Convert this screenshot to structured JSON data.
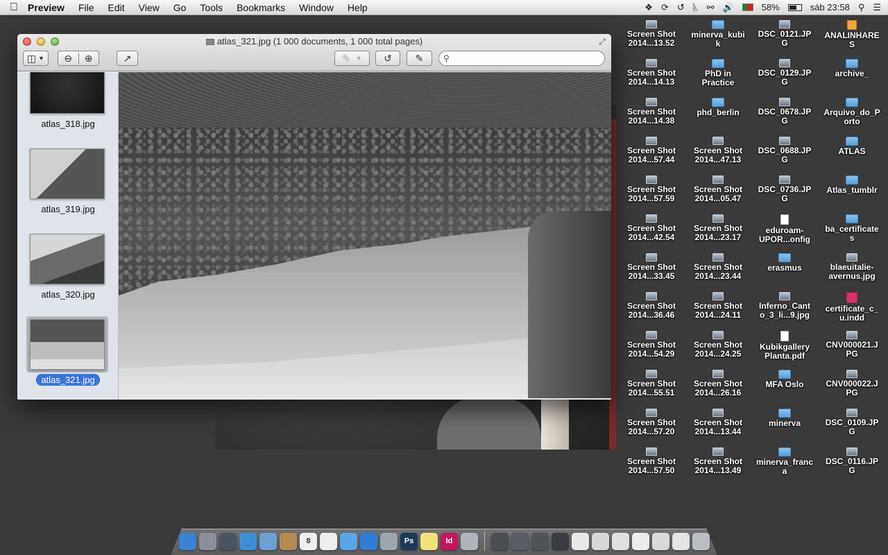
{
  "menubar": {
    "app_name": "Preview",
    "items": [
      "File",
      "Edit",
      "View",
      "Go",
      "Tools",
      "Bookmarks",
      "Window",
      "Help"
    ],
    "battery_percent": "58%",
    "clock": "sáb 23:58"
  },
  "window": {
    "title": "atlas_321.jpg (1 000 documents, 1 000 total pages)",
    "search_placeholder": ""
  },
  "sidebar": {
    "items": [
      {
        "label": "atlas_318.jpg",
        "selected": false
      },
      {
        "label": "atlas_319.jpg",
        "selected": false
      },
      {
        "label": "atlas_320.jpg",
        "selected": false
      },
      {
        "label": "atlas_321.jpg",
        "selected": true
      }
    ]
  },
  "desktop": {
    "col1": [
      [
        "Screen Shot",
        "2014...13.52"
      ],
      [
        "Screen Shot",
        "2014...14.13"
      ],
      [
        "Screen Shot",
        "2014...14.38"
      ],
      [
        "Screen Shot",
        "2014...57.44"
      ],
      [
        "Screen Shot",
        "2014...57.59"
      ],
      [
        "Screen Shot",
        "2014...42.54"
      ],
      [
        "Screen Shot",
        "2014...33.45"
      ],
      [
        "Screen Shot",
        "2014...36.46"
      ],
      [
        "Screen Shot",
        "2014...54.29"
      ],
      [
        "Screen Shot",
        "2014...55.51"
      ],
      [
        "Screen Shot",
        "2014...57.20"
      ],
      [
        "Screen Shot",
        "2014...57.50"
      ]
    ],
    "col2": [
      [
        "minerva_kubi",
        "k"
      ],
      [
        "PhD in",
        "Practice"
      ],
      [
        "phd_berlin",
        ""
      ],
      [
        "Screen Shot",
        "2014...47.13"
      ],
      [
        "Screen Shot",
        "2014...05.47"
      ],
      [
        "Screen Shot",
        "2014...23.17"
      ],
      [
        "Screen Shot",
        "2014...23.44"
      ],
      [
        "Screen Shot",
        "2014...24.11"
      ],
      [
        "Screen Shot",
        "2014...24.25"
      ],
      [
        "Screen Shot",
        "2014...26.16"
      ],
      [
        "Screen Shot",
        "2014...13.44"
      ],
      [
        "Screen Shot",
        "2014...13.49"
      ]
    ],
    "col3": [
      [
        "DSC_0121.JP",
        "G"
      ],
      [
        "DSC_0129.JP",
        "G"
      ],
      [
        "DSC_0678.JP",
        "G"
      ],
      [
        "DSC_0688.JP",
        "G"
      ],
      [
        "DSC_0736.JP",
        "G"
      ],
      [
        "eduroam-",
        "UPOR...onfig"
      ],
      [
        "erasmus",
        ""
      ],
      [
        "Inferno_Cant",
        "o_3_li...9.jpg"
      ],
      [
        "Kubikgallery",
        "Planta.pdf"
      ],
      [
        "MFA Oslo",
        ""
      ],
      [
        "minerva",
        ""
      ],
      [
        "minerva_franc",
        "a"
      ]
    ],
    "col4": [
      [
        "ANALINHARE",
        "S"
      ],
      [
        "archive_",
        ""
      ],
      [
        "Arquivo_do_P",
        "orto"
      ],
      [
        "ATLAS",
        ""
      ],
      [
        "Atlas_tumblr",
        ""
      ],
      [
        "ba_certificate",
        "s"
      ],
      [
        "blaeuitalie-",
        "avernus.jpg"
      ],
      [
        "certificate_c_",
        "u.indd"
      ],
      [
        "CNV000021.J",
        "PG"
      ],
      [
        "CNV000022.J",
        "PG"
      ],
      [
        "DSC_0109.JP",
        "G"
      ],
      [
        "DSC_0116.JP",
        "G"
      ]
    ]
  },
  "dock": {
    "apps": [
      {
        "icon": "finder-icon",
        "color": "#3b82d6",
        "text": ""
      },
      {
        "icon": "launchpad-icon",
        "color": "#8a8f99",
        "text": ""
      },
      {
        "icon": "mission-control-icon",
        "color": "#4a5560",
        "text": ""
      },
      {
        "icon": "safari-icon",
        "color": "#3f8ed8",
        "text": ""
      },
      {
        "icon": "mail-icon",
        "color": "#6ea0d8",
        "text": ""
      },
      {
        "icon": "contacts-icon",
        "color": "#b48a52",
        "text": ""
      },
      {
        "icon": "calendar-icon",
        "color": "#f0f0f0",
        "text": "8"
      },
      {
        "icon": "notes-icon",
        "color": "#eeeeee",
        "text": ""
      },
      {
        "icon": "messages-icon",
        "color": "#58a6e8",
        "text": ""
      },
      {
        "icon": "itunes-icon",
        "color": "#2f7fd6",
        "text": ""
      },
      {
        "icon": "preview-icon",
        "color": "#9ea6ad",
        "text": ""
      },
      {
        "icon": "photoshop-icon",
        "color": "#1c3b5a",
        "text": "Ps"
      },
      {
        "icon": "stickies-icon",
        "color": "#f3e27a",
        "text": ""
      },
      {
        "icon": "indesign-icon",
        "color": "#c2185b",
        "text": "Id"
      },
      {
        "icon": "image-capture-icon",
        "color": "#b0b5bb",
        "text": ""
      }
    ],
    "stack": [
      {
        "icon": "screenshot-stack-icon",
        "color": "#4b4f55"
      },
      {
        "icon": "screenshot-stack-icon",
        "color": "#5a5e64"
      },
      {
        "icon": "screenshot-stack-icon",
        "color": "#50545a"
      },
      {
        "icon": "applications-stack-icon",
        "color": "#3a3e44"
      },
      {
        "icon": "document-stack-icon",
        "color": "#e8e8e8"
      },
      {
        "icon": "document-stack-icon",
        "color": "#d8d8d8"
      },
      {
        "icon": "document-stack-icon",
        "color": "#e0e0e0"
      },
      {
        "icon": "document-stack-icon",
        "color": "#ececec"
      },
      {
        "icon": "document-stack-icon",
        "color": "#dadada"
      },
      {
        "icon": "document-stack-icon",
        "color": "#e4e4e4"
      },
      {
        "icon": "trash-icon",
        "color": "#b9bec4"
      }
    ]
  }
}
